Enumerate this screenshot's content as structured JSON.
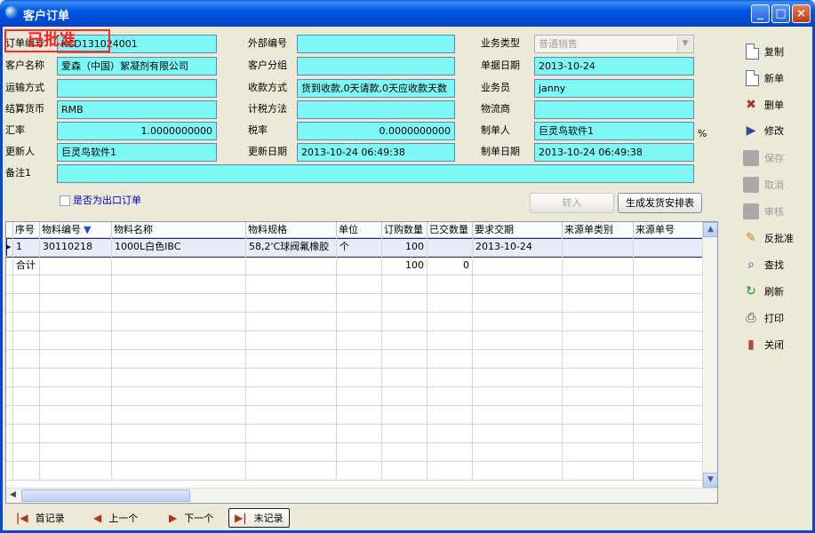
{
  "window": {
    "title": "客户订单",
    "controls": {
      "minimize": "_",
      "maximize": "□",
      "close": "×"
    }
  },
  "status_stamp": "已批准",
  "form": {
    "order_no": {
      "label": "订单编号",
      "value": "KCD131024001"
    },
    "customer_name": {
      "label": "客户名称",
      "value": "爱森（中国）絮凝剂有限公司"
    },
    "shipping_method": {
      "label": "运输方式",
      "value": ""
    },
    "currency": {
      "label": "结算货币",
      "value": "RMB"
    },
    "exchange_rate": {
      "label": "汇率",
      "value": "1.0000000000"
    },
    "updated_by": {
      "label": "更新人",
      "value": "巨灵鸟软件1"
    },
    "remark": {
      "label": "备注1",
      "value": ""
    },
    "external_no": {
      "label": "外部编号",
      "value": ""
    },
    "customer_group": {
      "label": "客户分组",
      "value": ""
    },
    "payment_method": {
      "label": "收款方式",
      "value": "货到收款,0天请款,0天应收款天数"
    },
    "tax_method": {
      "label": "计税方法",
      "value": ""
    },
    "tax_rate": {
      "label": "税率",
      "value": "0.0000000000"
    },
    "update_date": {
      "label": "更新日期",
      "value": "2013-10-24 06:49:38"
    },
    "business_type": {
      "label": "业务类型",
      "value": "普通销售"
    },
    "doc_date": {
      "label": "单据日期",
      "value": "2013-10-24"
    },
    "salesperson": {
      "label": "业务员",
      "value": "janny"
    },
    "logistics": {
      "label": "物流商",
      "value": ""
    },
    "creator": {
      "label": "制单人",
      "value": "巨灵鸟软件1"
    },
    "create_date": {
      "label": "制单日期",
      "value": "2013-10-24 06:49:38"
    },
    "percent_sign": "%",
    "export_checkbox_label": "是否为出口订单",
    "transfer_button": "转入",
    "generate_button": "生成发货安排表"
  },
  "toolbar": [
    {
      "label": "复制",
      "icon": "copy-icon",
      "enabled": true
    },
    {
      "label": "新单",
      "icon": "new-document-icon",
      "enabled": true
    },
    {
      "label": "删单",
      "icon": "delete-icon",
      "enabled": true
    },
    {
      "label": "修改",
      "icon": "edit-icon",
      "enabled": true
    },
    {
      "label": "保存",
      "icon": "save-icon",
      "enabled": false
    },
    {
      "label": "取消",
      "icon": "cancel-icon",
      "enabled": false
    },
    {
      "label": "审核",
      "icon": "approve-icon",
      "enabled": false
    },
    {
      "label": "反批准",
      "icon": "pencil-icon",
      "enabled": true
    },
    {
      "label": "查找",
      "icon": "search-icon",
      "enabled": true
    },
    {
      "label": "刷新",
      "icon": "refresh-icon",
      "enabled": true
    },
    {
      "label": "打印",
      "icon": "printer-icon",
      "enabled": true
    },
    {
      "label": "关闭",
      "icon": "close-door-icon",
      "enabled": true
    }
  ],
  "grid": {
    "columns": [
      "序号",
      "物料编号",
      "物料名称",
      "物料规格",
      "单位",
      "订购数量",
      "已交数量",
      "要求交期",
      "来源单类别",
      "来源单号"
    ],
    "sort_indicator": "▼",
    "rows": [
      [
        "1",
        "30110218",
        "1000L白色IBC",
        "58,2'C球阀氟橡胶",
        "个",
        "100",
        "",
        "2013-10-24",
        "",
        ""
      ]
    ],
    "total_row": [
      "合计",
      "",
      "",
      "",
      "",
      "100",
      "0",
      "",
      "",
      ""
    ]
  },
  "nav": {
    "first": "首记录",
    "prev": "上一个",
    "next": "下一个",
    "last": "末记录"
  }
}
